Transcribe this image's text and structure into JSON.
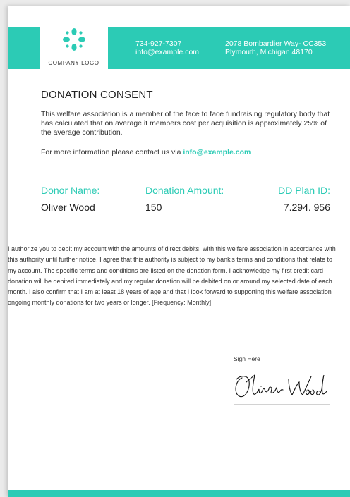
{
  "header": {
    "logo_text": "COMPANY LOGO",
    "phone": "734-927-7307",
    "email": "info@example.com",
    "address_line1": "2078 Bombardier Way-  CC353",
    "address_line2": "Plymouth, Michigan  48170"
  },
  "document": {
    "title": "DONATION CONSENT",
    "intro": "This welfare association is a member of the face to face fundraising regulatory body that has calculated that on average it members cost per acquisition is approximately 25% of the average contribution.",
    "contact_prefix": "For more information please contact us via ",
    "contact_email": "info@example.com"
  },
  "fields": {
    "donor_name_label": "Donor Name:",
    "donor_name_value": "Oliver Wood",
    "donation_amount_label": "Donation Amount:",
    "donation_amount_value": "150",
    "dd_plan_label": "DD Plan ID:",
    "dd_plan_value": "7.294. 956"
  },
  "authorization": "I authorize you to debit my account with the amounts of direct debits, with this welfare association in accordance with this authority until further notice. I agree that this authority is subject to my bank's terms and conditions that relate to my account. The specific terms and conditions are listed on the donation form. I acknowledge my first credit card donation will be debited immediately and my regular donation will be debited on or around my selected date of each month. I also confirm that I am at least 18 years of age and that I look forward to supporting this welfare association ongoing monthly donations for two years or longer. [Frequency: Monthly]",
  "signature": {
    "label": "Sign Here",
    "signature_text": "Oliver Wood"
  },
  "colors": {
    "accent": "#2ccbb5",
    "page_background": "#ebebeb",
    "sheet": "#ffffff"
  },
  "icons": {
    "logo": "company-logo-icon"
  }
}
